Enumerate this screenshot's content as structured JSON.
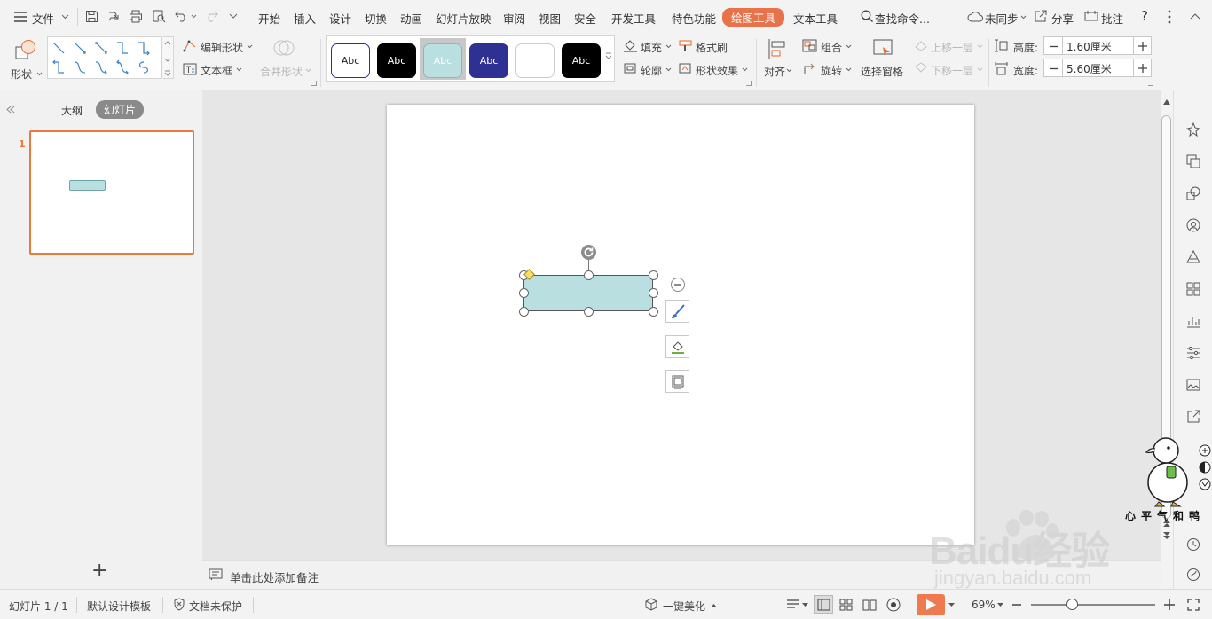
{
  "menubar": {
    "file": "文件",
    "tabs": [
      "开始",
      "插入",
      "设计",
      "切换",
      "动画",
      "幻灯片放映",
      "审阅",
      "视图",
      "安全",
      "开发工具",
      "特色功能",
      "绘图工具",
      "文本工具"
    ],
    "active_tab": "绘图工具",
    "search": "查找命令...",
    "sync": "未同步",
    "share": "分享",
    "comment": "批注",
    "help": "?"
  },
  "ribbon": {
    "shape": "形状",
    "edit_shape": "编辑形状",
    "text_box": "文本框",
    "merge_shape": "合并形状",
    "style_samples": [
      "Abc",
      "Abc",
      "Abc",
      "Abc",
      "",
      "Abc"
    ],
    "fill": "填充",
    "format_painter": "格式刷",
    "outline": "轮廓",
    "shape_effect": "形状效果",
    "align": "对齐",
    "group": "组合",
    "rotate": "旋转",
    "selection_pane": "选择窗格",
    "bring_forward": "上移一层",
    "send_backward": "下移一层",
    "height_label": "高度:",
    "height_value": "1.60厘米",
    "width_label": "宽度:",
    "width_value": "5.60厘米"
  },
  "leftpane": {
    "tab_outline": "大纲",
    "tab_slides": "幻灯片",
    "slide_number": "1",
    "add": "+"
  },
  "notes_placeholder": "单击此处添加备注",
  "status": {
    "slide_info": "幻灯片 1 / 1",
    "template": "默认设计模板",
    "protection": "文档未保护",
    "beautify": "一键美化",
    "zoom": "69%"
  },
  "watermark": {
    "sticker_text": "心平气和鸭",
    "brand": "Baidu经验",
    "url": "jingyan.baidu.com"
  },
  "colors": {
    "accent": "#e8734a",
    "shape_fill": "#b9dfe1",
    "thumb_border": "#e8793f"
  }
}
